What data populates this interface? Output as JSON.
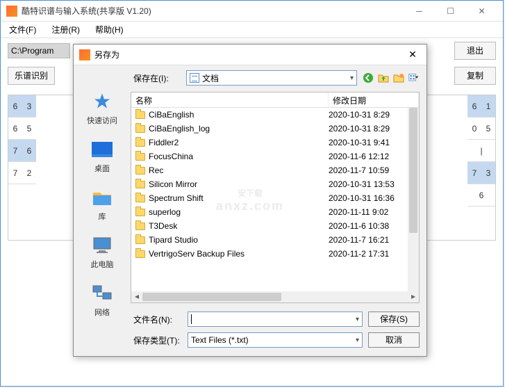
{
  "main": {
    "title": "酷特识谱与输入系统(共享版 V1.20)",
    "menu": {
      "file": "文件(F)",
      "register": "注册(R)",
      "help": "帮助(H)"
    },
    "path": "C:\\Program",
    "buttons": {
      "score": "乐谱识别",
      "exit": "退出",
      "copy": "复制"
    },
    "leftGrid": [
      [
        "6",
        "3"
      ],
      [
        "6",
        "5"
      ],
      [
        "7",
        "6"
      ],
      [
        "7",
        "2"
      ]
    ],
    "rightGrid": [
      [
        "6",
        "1"
      ],
      [
        "0",
        "5"
      ],
      [
        "",
        ""
      ],
      [
        "7",
        "3"
      ],
      [
        "",
        "6"
      ]
    ]
  },
  "dialog": {
    "title": "另存为",
    "lookin_label": "保存在(I):",
    "lookin_value": "文档",
    "sidebar": [
      {
        "label": "快速访问",
        "name": "quick-access"
      },
      {
        "label": "桌面",
        "name": "desktop"
      },
      {
        "label": "库",
        "name": "libraries"
      },
      {
        "label": "此电脑",
        "name": "this-pc"
      },
      {
        "label": "网络",
        "name": "network"
      }
    ],
    "columns": {
      "name": "名称",
      "date": "修改日期"
    },
    "files": [
      {
        "name": "CiBaEnglish",
        "date": "2020-10-31 8:29"
      },
      {
        "name": "CiBaEnglish_log",
        "date": "2020-10-31 8:29"
      },
      {
        "name": "Fiddler2",
        "date": "2020-10-31 9:41"
      },
      {
        "name": "FocusChina",
        "date": "2020-11-6 12:12"
      },
      {
        "name": "Rec",
        "date": "2020-11-7 10:59"
      },
      {
        "name": "Silicon Mirror",
        "date": "2020-10-31 13:53"
      },
      {
        "name": "Spectrum Shift",
        "date": "2020-10-31 16:36"
      },
      {
        "name": "superlog",
        "date": "2020-11-11 9:02"
      },
      {
        "name": "T3Desk",
        "date": "2020-11-6 10:38"
      },
      {
        "name": "Tipard Studio",
        "date": "2020-11-7 16:21"
      },
      {
        "name": "VertrigoServ Backup Files",
        "date": "2020-11-2 17:31"
      }
    ],
    "filename_label": "文件名(N):",
    "filename_value": "",
    "filetype_label": "保存类型(T):",
    "filetype_value": "Text Files (*.txt)",
    "save_btn": "保存(S)",
    "cancel_btn": "取消"
  },
  "watermark": {
    "main": "安下载",
    "sub": "anxz.com"
  }
}
